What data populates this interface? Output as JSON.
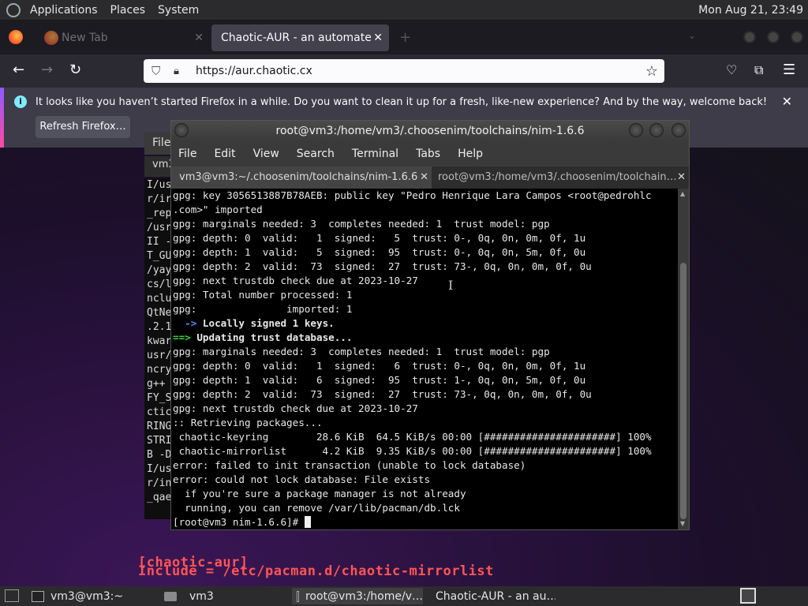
{
  "top_panel": {
    "menus": [
      "Applications",
      "Places",
      "System"
    ],
    "clock": "Mon Aug 21, 23:49"
  },
  "firefox": {
    "tabs": [
      {
        "title": "New Tab",
        "active": false
      },
      {
        "title": "Chaotic-AUR - an automated bu",
        "active": true
      }
    ],
    "url": "https://aur.chaotic.cx",
    "notification": {
      "text": "It looks like you haven’t started Firefox in a while. Do you want to clean it up for a fresh, like-new experience? And by the way, welcome back!",
      "button": "Refresh Firefox…"
    }
  },
  "webpage": {
    "lines": [
      "[chaotic-aur]",
      "Include = /etc/pacman.d/chaotic-mirrorlist"
    ],
    "line_color": "#ff5555"
  },
  "bg_terminal": {
    "menu_fragment": "File",
    "tab_fragment": "vm3",
    "lines": [
      "I/us",
      "r/ir",
      "_rep",
      "/usr",
      "II -",
      "T_GU",
      "/yay",
      "cs/l",
      "nclu",
      "QtNe",
      ".2.1",
      "kwar",
      "usr/",
      "ncry",
      "g++ ",
      "FY_S",
      "ctic",
      "RING",
      "STRI",
      "B -D",
      "I/us",
      "r/in",
      "_qae",
      ""
    ]
  },
  "terminal": {
    "title": "root@vm3:/home/vm3/.choosenim/toolchains/nim-1.6.6",
    "menu": [
      "File",
      "Edit",
      "View",
      "Search",
      "Terminal",
      "Tabs",
      "Help"
    ],
    "tabs": [
      "vm3@vm3:~/.choosenim/toolchains/nim-1.6.6",
      "root@vm3:/home/vm3/.choosenim/toolchain…"
    ],
    "lines": [
      {
        "style": "",
        "text": "gpg: key 3056513887B78AEB: public key \"Pedro Henrique Lara Campos <root@pedrohlc"
      },
      {
        "style": "",
        "text": ".com>\" imported"
      },
      {
        "style": "",
        "text": "gpg: marginals needed: 3  completes needed: 1  trust model: pgp"
      },
      {
        "style": "",
        "text": "gpg: depth: 0  valid:   1  signed:   5  trust: 0-, 0q, 0n, 0m, 0f, 1u"
      },
      {
        "style": "",
        "text": "gpg: depth: 1  valid:   5  signed:  95  trust: 0-, 0q, 0n, 5m, 0f, 0u"
      },
      {
        "style": "",
        "text": "gpg: depth: 2  valid:  73  signed:  27  trust: 73-, 0q, 0n, 0m, 0f, 0u"
      },
      {
        "style": "",
        "text": "gpg: next trustdb check due at 2023-10-27"
      },
      {
        "style": "",
        "text": "gpg: Total number processed: 1"
      },
      {
        "style": "",
        "text": "gpg:               imported: 1"
      },
      {
        "style": "arrow",
        "prefix": "  -> ",
        "text": "Locally signed 1 keys."
      },
      {
        "style": "arrow2",
        "prefix": "==> ",
        "text": "Updating trust database..."
      },
      {
        "style": "",
        "text": "gpg: marginals needed: 3  completes needed: 1  trust model: pgp"
      },
      {
        "style": "",
        "text": "gpg: depth: 0  valid:   1  signed:   6  trust: 0-, 0q, 0n, 0m, 0f, 1u"
      },
      {
        "style": "",
        "text": "gpg: depth: 1  valid:   6  signed:  95  trust: 1-, 0q, 0n, 5m, 0f, 0u"
      },
      {
        "style": "",
        "text": "gpg: depth: 2  valid:  73  signed:  27  trust: 73-, 0q, 0n, 0m, 0f, 0u"
      },
      {
        "style": "",
        "text": "gpg: next trustdb check due at 2023-10-27"
      },
      {
        "style": "",
        "text": ":: Retrieving packages..."
      },
      {
        "style": "",
        "text": " chaotic-keyring        28.6 KiB  64.5 KiB/s 00:00 [######################] 100%"
      },
      {
        "style": "",
        "text": " chaotic-mirrorlist      4.2 KiB  9.35 KiB/s 00:00 [######################] 100%"
      },
      {
        "style": "",
        "text": "error: failed to init transaction (unable to lock database)"
      },
      {
        "style": "",
        "text": "error: could not lock database: File exists"
      },
      {
        "style": "",
        "text": "  if you're sure a package manager is not already"
      },
      {
        "style": "",
        "text": "  running, you can remove /var/lib/pacman/db.lck"
      },
      {
        "style": "prompt",
        "text": "[root@vm3 nim-1.6.6]# "
      }
    ]
  },
  "taskbar": {
    "tasks": [
      {
        "label": "vm3@vm3:~",
        "icon": "terminal-icon",
        "active": false
      },
      {
        "label": "vm3",
        "icon": "folder-icon",
        "active": false
      },
      {
        "label": "root@vm3:/home/v…",
        "icon": "terminal-icon",
        "active": true
      },
      {
        "label": "Chaotic-AUR - an au…",
        "icon": "firefox-icon",
        "active": false
      }
    ]
  }
}
